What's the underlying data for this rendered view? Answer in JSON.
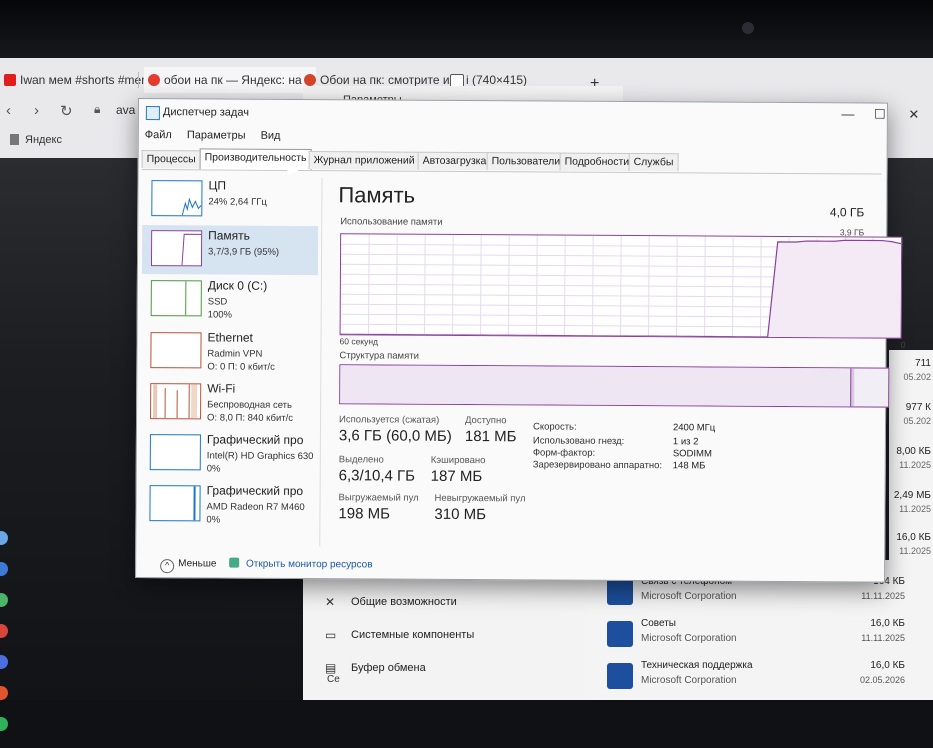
{
  "browser": {
    "tabs": [
      {
        "label": "Iwan мем #shorts #meme",
        "favicon_color": "#e11d1d"
      },
      {
        "label": "обои на пк — Яндекс: на",
        "favicon_color": "#e63b2e"
      },
      {
        "label": "Обои на пк: смотрите и",
        "favicon_color": "#d2452a"
      },
      {
        "label": "i (740×415)",
        "favicon_color": "#555555"
      }
    ],
    "new_tab": "+",
    "address": "ava",
    "bookmark": "Яндекс"
  },
  "settings_window": {
    "title": "Параметры",
    "items": [
      {
        "label": "Общие возможности",
        "icon": "share-icon"
      },
      {
        "label": "Системные компоненты",
        "icon": "components-icon"
      },
      {
        "label": "Буфер обмена",
        "icon": "clipboard-icon"
      }
    ],
    "left_icon_text": "Се"
  },
  "app_list": [
    {
      "name": "Связь с телефоном",
      "publisher": "Microsoft Corporation",
      "size": "164 КБ",
      "date": "11.11.2025"
    },
    {
      "name": "Советы",
      "publisher": "Microsoft Corporation",
      "size": "16,0 КБ",
      "date": "11.11.2025"
    },
    {
      "name": "Техническая поддержка",
      "publisher": "Microsoft Corporation",
      "size": "16,0 КБ",
      "date": "02.05.2026"
    }
  ],
  "right_column": [
    {
      "size": "711",
      "date": "05.202"
    },
    {
      "size": "977 К",
      "date": "05.202"
    },
    {
      "size": "8,00 КБ",
      "date": "11.2025"
    },
    {
      "size": "2,49 МБ",
      "date": "11.2025"
    },
    {
      "size": "16,0 КБ",
      "date": "11.2025"
    }
  ],
  "task_manager": {
    "title": "Диспетчер задач",
    "controls": {
      "minimize": "—",
      "maximize": "☐",
      "close": "✕"
    },
    "menu": [
      "Файл",
      "Параметры",
      "Вид"
    ],
    "tabs": [
      "Процессы",
      "Производительность",
      "Журнал приложений",
      "Автозагрузка",
      "Пользователи",
      "Подробности",
      "Службы"
    ],
    "active_tab": "Производительность",
    "sidebar": [
      {
        "name": "ЦП",
        "line1": "24% 2,64 ГГц",
        "line2": "",
        "color": "#1a76c9"
      },
      {
        "name": "Память",
        "line1": "3,7/3,9 ГБ (95%)",
        "line2": "",
        "color": "#8b3f9e"
      },
      {
        "name": "Диск 0 (C:)",
        "line1": "SSD",
        "line2": "100%",
        "color": "#4a9a3a"
      },
      {
        "name": "Ethernet",
        "line1": "Radmin VPN",
        "line2": "О: 0 П: 0 кбит/с",
        "color": "#b5533a"
      },
      {
        "name": "Wi-Fi",
        "line1": "Беспроводная сеть",
        "line2": "О: 8,0 П: 840 кбит/с",
        "color": "#b5533a"
      },
      {
        "name": "Графический про",
        "line1": "Intel(R) HD Graphics 630",
        "line2": "0%",
        "color": "#1a76c9"
      },
      {
        "name": "Графический про",
        "line1": "AMD Radeon R7 M460",
        "line2": "0%",
        "color": "#1a76c9"
      }
    ],
    "memory": {
      "title": "Память",
      "total": "4,0 ГБ",
      "usage_label": "Использование памяти",
      "max_label": "3,9 ГБ",
      "time_label": "60 секунд",
      "zero_label": "0",
      "structure_label": "Структура памяти",
      "stats": {
        "in_use": {
          "label": "Используется (сжатая)",
          "value": "3,6 ГБ (60,0 МБ)"
        },
        "available": {
          "label": "Доступно",
          "value": "181 МБ"
        },
        "committed": {
          "label": "Выделено",
          "value": "6,3/10,4 ГБ"
        },
        "cached": {
          "label": "Кэшировано",
          "value": "187 МБ"
        },
        "paged_pool": {
          "label": "Выгружаемый пул",
          "value": "198 МБ"
        },
        "nonpaged_pool": {
          "label": "Невыгружаемый пул",
          "value": "310 МБ"
        }
      },
      "details": [
        {
          "key": "Скорость:",
          "value": "2400 МГц"
        },
        {
          "key": "Использовано гнезд:",
          "value": "1 из 2"
        },
        {
          "key": "Форм-фактор:",
          "value": "SODIMM"
        },
        {
          "key": "Зарезервировано аппаратно:",
          "value": "148 МБ"
        }
      ],
      "graph_used_fraction_history": [
        0,
        0,
        0,
        0,
        0,
        0,
        0,
        0,
        0,
        0,
        0,
        0,
        0,
        0,
        0,
        0,
        0,
        0,
        0,
        0,
        0,
        0,
        0,
        0,
        0,
        0,
        0,
        0,
        0,
        0,
        0,
        0,
        0,
        0,
        0,
        0,
        0,
        0,
        0,
        0,
        0,
        0,
        0,
        0,
        0,
        0,
        0.95,
        0.95,
        0.95,
        0.96,
        0.96,
        0.96,
        0.96,
        0.97,
        0.97,
        0.97,
        0.97,
        0.97,
        0.96,
        0.94
      ],
      "structure_used_fraction": 0.93,
      "graph_color": "#8b3f9e"
    },
    "footer": {
      "less": "Меньше",
      "resource_monitor": "Открыть монитор ресурсов"
    }
  }
}
